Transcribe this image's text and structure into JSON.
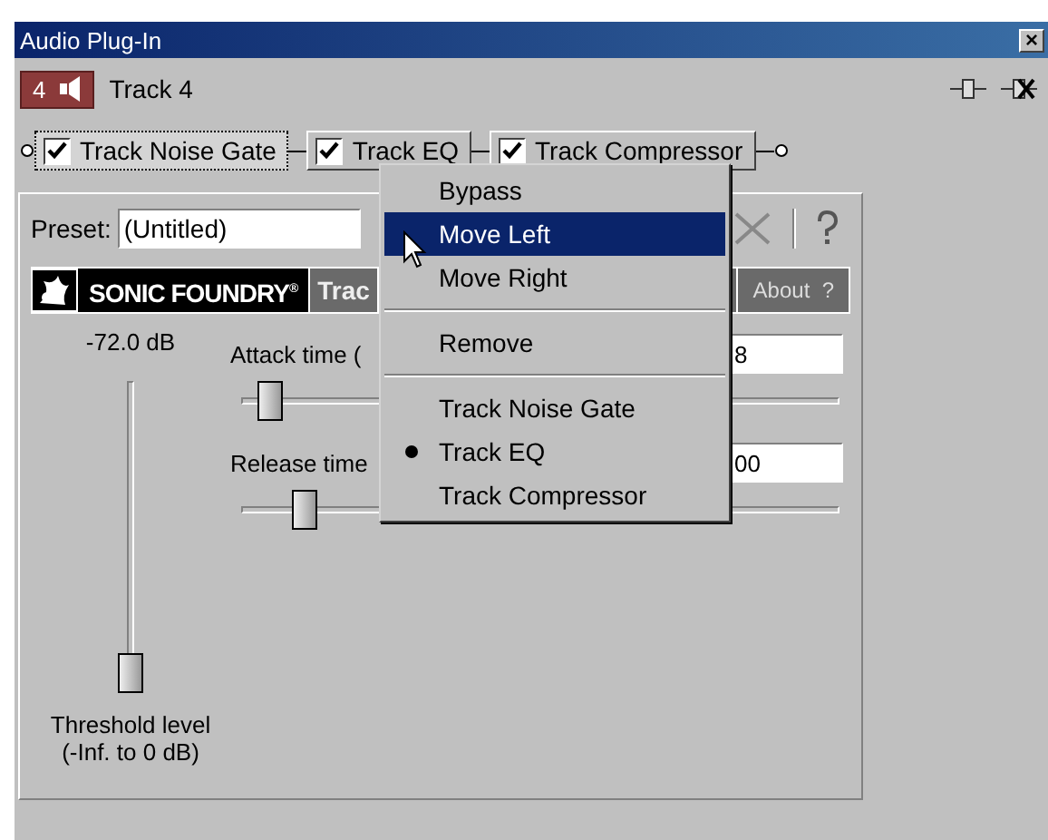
{
  "window": {
    "title": "Audio Plug-In",
    "close": "×"
  },
  "track": {
    "number": "4",
    "name": "Track 4"
  },
  "chain": [
    {
      "label": "Track Noise Gate",
      "checked": true,
      "selected": true
    },
    {
      "label": "Track EQ",
      "checked": true,
      "selected": false
    },
    {
      "label": "Track Compressor",
      "checked": true,
      "selected": false
    }
  ],
  "preset": {
    "label": "Preset:",
    "value": "(Untitled)"
  },
  "header": {
    "brand": "SONIC FOUNDRY",
    "brand_mark": "®",
    "plugin": "Trac",
    "about": "About  ?"
  },
  "threshold": {
    "reading": "-72.0 dB",
    "level": 0,
    "label": "Threshold level",
    "range": "(-Inf. to 0 dB)"
  },
  "sliders": [
    {
      "label": "Attack time (",
      "value": "8",
      "level": 0.03
    },
    {
      "label": "Release time",
      "value": "00",
      "level": 0.09
    }
  ],
  "menu": {
    "items": [
      {
        "kind": "item",
        "label": "Bypass",
        "selected": false
      },
      {
        "kind": "item",
        "label": "Move Left",
        "selected": true
      },
      {
        "kind": "item",
        "label": "Move Right",
        "selected": false
      },
      {
        "kind": "separator"
      },
      {
        "kind": "item",
        "label": "Remove",
        "selected": false
      },
      {
        "kind": "separator"
      },
      {
        "kind": "radio",
        "label": "Track Noise Gate",
        "checked": false,
        "selected": false
      },
      {
        "kind": "radio",
        "label": "Track EQ",
        "checked": true,
        "selected": false
      },
      {
        "kind": "radio",
        "label": "Track Compressor",
        "checked": false,
        "selected": false
      }
    ]
  }
}
